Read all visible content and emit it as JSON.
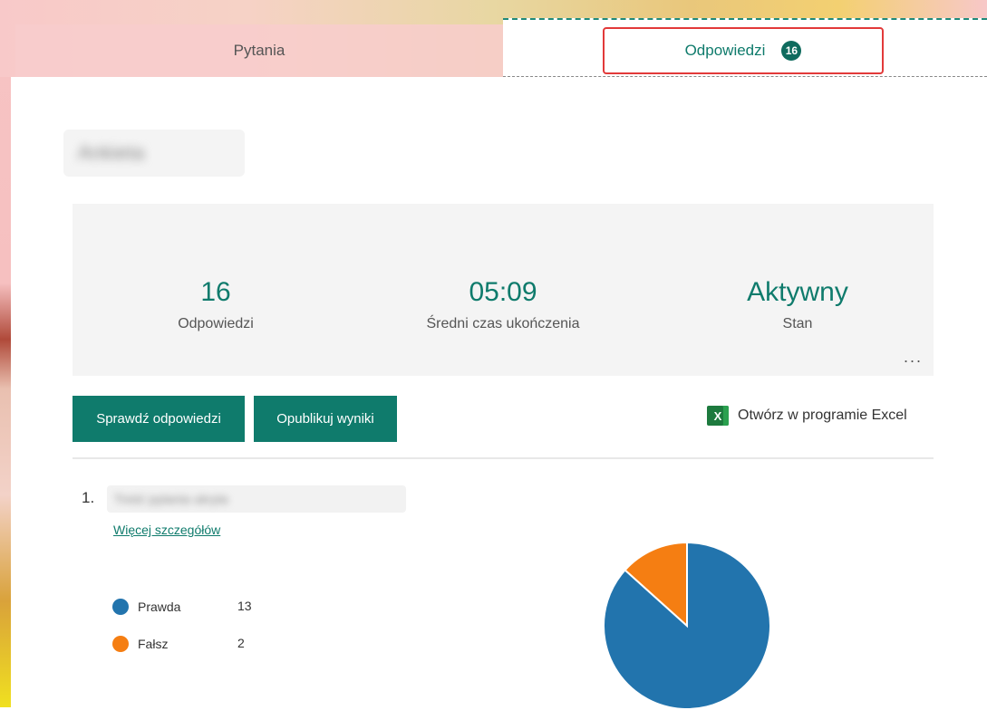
{
  "tabs": {
    "questions_label": "Pytania",
    "responses_label": "Odpowiedzi",
    "responses_count": "16"
  },
  "form": {
    "title": "Ankieta"
  },
  "stats": {
    "responses_value": "16",
    "responses_label": "Odpowiedzi",
    "avg_time_value": "05:09",
    "avg_time_label": "Średni czas ukończenia",
    "status_value": "Aktywny",
    "status_label": "Stan",
    "more_label": "..."
  },
  "actions": {
    "review_label": "Sprawdź odpowiedzi",
    "publish_label": "Opublikuj wyniki",
    "excel_label": "Otwórz w programie Excel",
    "excel_icon": "X"
  },
  "question": {
    "number": "1.",
    "text": "Treść pytania ukryta",
    "details_label": "Więcej szczegółów"
  },
  "chart_data": {
    "type": "pie",
    "categories": [
      "Prawda",
      "Fałsz"
    ],
    "values": [
      13,
      2
    ],
    "colors": [
      "#2274ad",
      "#f57e12"
    ]
  }
}
